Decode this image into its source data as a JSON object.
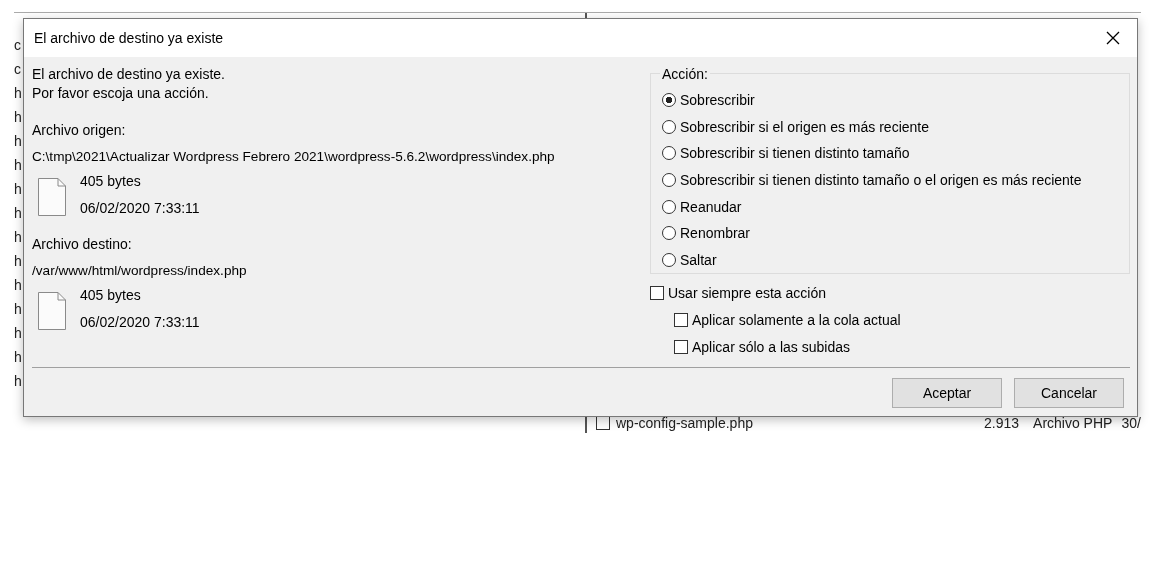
{
  "background": {
    "left_fragments": [
      "c",
      "c",
      "h",
      "h",
      "h",
      "h",
      "h",
      "h",
      "h",
      "h",
      "h",
      "h",
      "h",
      "h",
      "h"
    ],
    "bottom_row": {
      "checked": false,
      "name": "wp-config-sample.php",
      "size": "2.913",
      "type": "Archivo PHP",
      "date": "30/"
    }
  },
  "dialog": {
    "title": "El archivo de destino ya existe",
    "message": [
      "El archivo de destino ya existe.",
      "Por favor escoja una acción."
    ],
    "files": [
      {
        "label": "Archivo origen:",
        "path": "C:\\tmp\\2021\\Actualizar Wordpress Febrero 2021\\wordpress-5.6.2\\wordpress\\index.php",
        "size": "405 bytes",
        "date": "06/02/2020 7:33:11"
      },
      {
        "label": "Archivo destino:",
        "path": "/var/www/html/wordpress/index.php",
        "size": "405 bytes",
        "date": "06/02/2020 7:33:11"
      }
    ],
    "action_group": {
      "label": "Acción:",
      "options": [
        {
          "label": "Sobrescribir",
          "selected": true
        },
        {
          "label": "Sobrescribir si el origen es más reciente",
          "selected": false
        },
        {
          "label": "Sobrescribir si tienen distinto tamaño",
          "selected": false
        },
        {
          "label": "Sobrescribir si tienen distinto tamaño o el origen es más reciente",
          "selected": false
        },
        {
          "label": "Reanudar",
          "selected": false
        },
        {
          "label": "Renombrar",
          "selected": false
        },
        {
          "label": "Saltar",
          "selected": false
        }
      ]
    },
    "always": {
      "label": "Usar siempre esta acción",
      "checked": false,
      "children": [
        {
          "label": "Aplicar solamente a la cola actual",
          "checked": false
        },
        {
          "label": "Aplicar sólo a las subidas",
          "checked": false
        }
      ]
    },
    "buttons": [
      "Aceptar",
      "Cancelar"
    ]
  }
}
